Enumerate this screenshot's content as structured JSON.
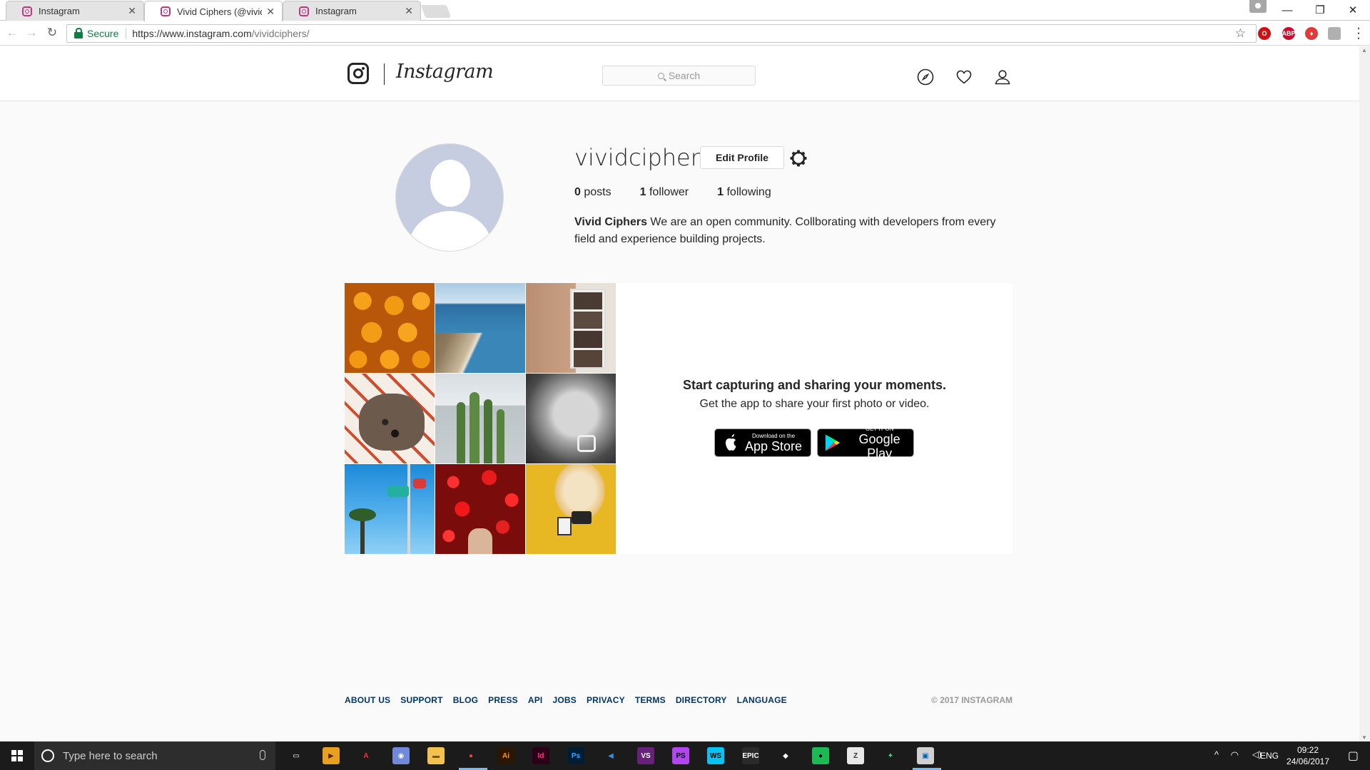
{
  "browser": {
    "tabs": [
      {
        "title": "Instagram",
        "active": false
      },
      {
        "title": "Vivid Ciphers (@vividcip",
        "active": true
      },
      {
        "title": "Instagram",
        "active": false
      }
    ],
    "tab_close": "✕",
    "window_controls": {
      "minimize": "—",
      "restore": "❐",
      "close": "✕"
    },
    "nav": {
      "back": "←",
      "forward": "→",
      "reload": "↻"
    },
    "secure_label": "Secure",
    "url_host": "https://www.instagram.com",
    "url_path": "/vividciphers/",
    "bookmark_star": "☆",
    "extensions": [
      {
        "name": "opera-icon",
        "label": "O",
        "color": "#cc1212"
      },
      {
        "name": "adblock-plus-icon",
        "label": "ABP",
        "color": "#c70d2c"
      },
      {
        "name": "shield-icon",
        "label": "♦",
        "color": "#e03a3a"
      },
      {
        "name": "extension-icon",
        "label": "",
        "color": "#b0b0b0"
      }
    ],
    "menu": "⋮"
  },
  "instagram": {
    "wordmark": "Instagram",
    "search_placeholder": "Search",
    "icons": [
      "compass-icon",
      "heart-icon",
      "person-icon"
    ]
  },
  "profile": {
    "username": "vividciphers",
    "edit_button": "Edit Profile",
    "stats": [
      {
        "num": "0",
        "label": "posts"
      },
      {
        "num": "1",
        "label": "follower"
      },
      {
        "num": "1",
        "label": "following"
      }
    ],
    "bio_name": "Vivid Ciphers",
    "bio_text": "We are an open community. Collborating with developers from every field and experience building projects."
  },
  "promo": {
    "title": "Start capturing and sharing your moments.",
    "subtitle": "Get the app to share your first photo or video.",
    "app_store": {
      "small": "Download on the",
      "big": "App Store"
    },
    "google_play": {
      "small": "GET IT ON",
      "big": "Google Play"
    },
    "photos": [
      "oranges-photo",
      "coast-photo",
      "photo-strip-photo",
      "dog-photo",
      "cactus-photo",
      "baby-photo",
      "ride-photo",
      "flowers-photo",
      "cat-photo"
    ]
  },
  "footer": {
    "links": [
      "ABOUT US",
      "SUPPORT",
      "BLOG",
      "PRESS",
      "API",
      "JOBS",
      "PRIVACY",
      "TERMS",
      "DIRECTORY",
      "LANGUAGE"
    ],
    "copyright": "© 2017 INSTAGRAM"
  },
  "taskbar": {
    "search_placeholder": "Type here to search",
    "apps": [
      {
        "name": "task-view-icon",
        "label": "▭",
        "bg": "#1b1b1b",
        "fg": "#ffffff"
      },
      {
        "name": "media-app-icon",
        "label": "▶",
        "bg": "#e8a020",
        "fg": "#5a2a00"
      },
      {
        "name": "acrobat-icon",
        "label": "A",
        "bg": "#1b1b1b",
        "fg": "#e53935"
      },
      {
        "name": "discord-icon",
        "label": "◉",
        "bg": "#7289da",
        "fg": "#ffffff"
      },
      {
        "name": "file-explorer-icon",
        "label": "▬",
        "bg": "#f2c14e",
        "fg": "#7a5a00"
      },
      {
        "name": "chrome-icon",
        "label": "●",
        "bg": "#1b1b1b",
        "fg": "#e8453c"
      },
      {
        "name": "illustrator-icon",
        "label": "Ai",
        "bg": "#2b1600",
        "fg": "#ff9a00"
      },
      {
        "name": "indesign-icon",
        "label": "Id",
        "bg": "#2d0019",
        "fg": "#ff3486"
      },
      {
        "name": "photoshop-icon",
        "label": "Ps",
        "bg": "#001d34",
        "fg": "#31a8ff"
      },
      {
        "name": "vscode-icon",
        "label": "◀",
        "bg": "#1b1b1b",
        "fg": "#2f8fdb"
      },
      {
        "name": "visual-studio-icon",
        "label": "VS",
        "bg": "#68217a",
        "fg": "#ffffff"
      },
      {
        "name": "phpstorm-icon",
        "label": "PS",
        "bg": "#b345f1",
        "fg": "#000000"
      },
      {
        "name": "webstorm-icon",
        "label": "WS",
        "bg": "#07c3f2",
        "fg": "#000000"
      },
      {
        "name": "epic-games-icon",
        "label": "EPIC",
        "bg": "#2a2a2a",
        "fg": "#ffffff"
      },
      {
        "name": "unity-icon",
        "label": "◆",
        "bg": "#1b1b1b",
        "fg": "#ffffff"
      },
      {
        "name": "spotify-icon",
        "label": "●",
        "bg": "#1db954",
        "fg": "#000000"
      },
      {
        "name": "zbrush-icon",
        "label": "Z",
        "bg": "#e8e8e8",
        "fg": "#333333"
      },
      {
        "name": "android-icon",
        "label": "✦",
        "bg": "#1b1b1b",
        "fg": "#3ddc84"
      },
      {
        "name": "remote-desktop-icon",
        "label": "▣",
        "bg": "#d0d0d0",
        "fg": "#0063b1"
      }
    ],
    "tray": {
      "caret": "^",
      "network": "◠",
      "volume": "◁)",
      "lang": "ENG",
      "notifications": "▢"
    },
    "time": "09:22",
    "date": "24/06/2017"
  }
}
